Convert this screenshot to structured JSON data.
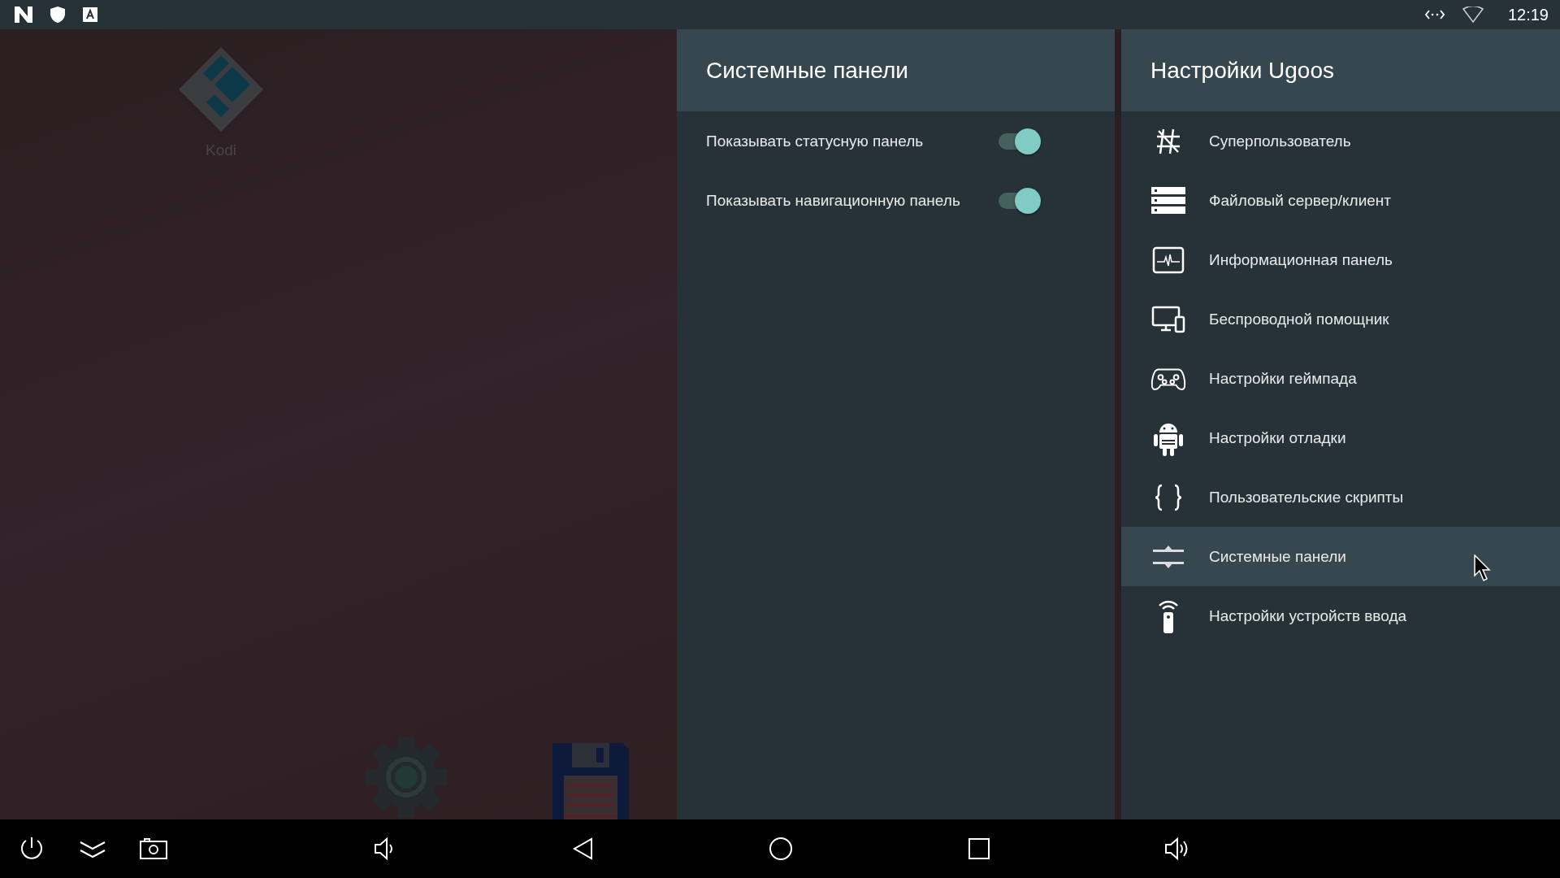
{
  "status_bar": {
    "time": "12:19"
  },
  "home": {
    "apps": [
      {
        "label": "Kodi"
      }
    ]
  },
  "detail_panel": {
    "title": "Системные панели",
    "settings": [
      {
        "label": "Показывать статусную панель",
        "on": true
      },
      {
        "label": "Показывать навигационную панель",
        "on": true
      }
    ]
  },
  "menu_panel": {
    "title": "Настройки Ugoos",
    "items": [
      {
        "kind": "superuser",
        "label": "Суперпользователь",
        "selected": false
      },
      {
        "kind": "server",
        "label": "Файловый сервер/клиент",
        "selected": false
      },
      {
        "kind": "monitor",
        "label": "Информационная панель",
        "selected": false
      },
      {
        "kind": "devices",
        "label": "Беспроводной помощник",
        "selected": false
      },
      {
        "kind": "gamepad",
        "label": "Настройки геймпада",
        "selected": false
      },
      {
        "kind": "android",
        "label": "Настройки отладки",
        "selected": false
      },
      {
        "kind": "braces",
        "label": "Пользовательские скрипты",
        "selected": false
      },
      {
        "kind": "bars",
        "label": "Системные панели",
        "selected": true
      },
      {
        "kind": "remote",
        "label": "Настройки устройств ввода",
        "selected": false
      }
    ]
  }
}
